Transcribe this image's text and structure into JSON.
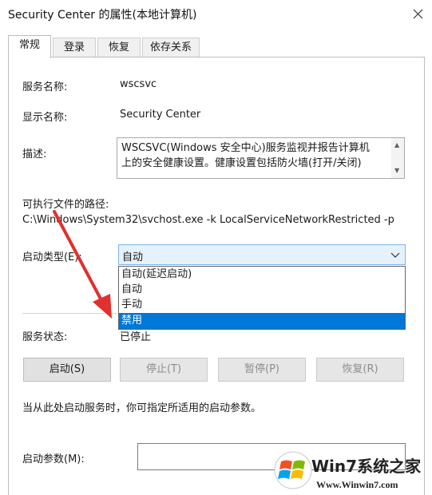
{
  "window": {
    "title": "Security Center 的属性(本地计算机)"
  },
  "tabs": [
    {
      "label": "常规",
      "active": true
    },
    {
      "label": "登录",
      "active": false
    },
    {
      "label": "恢复",
      "active": false
    },
    {
      "label": "依存关系",
      "active": false
    }
  ],
  "general": {
    "service_name_label": "服务名称:",
    "service_name_value": "wscsvc",
    "display_name_label": "显示名称:",
    "display_name_value": "Security Center",
    "description_label": "描述:",
    "description_value": "WSCSVC(Windows 安全中心)服务监视并报告计算机\n上的安全健康设置。健康设置包括防火墙(打开/关闭)",
    "path_label": "可执行文件的路径:",
    "path_value": "C:\\Windows\\System32\\svchost.exe -k LocalServiceNetworkRestricted -p",
    "startup_type_label": "启动类型(E):",
    "startup_type_value": "自动",
    "startup_options": [
      {
        "label": "自动(延迟启动)",
        "selected": false
      },
      {
        "label": "自动",
        "selected": false
      },
      {
        "label": "手动",
        "selected": false
      },
      {
        "label": "禁用",
        "selected": true
      }
    ],
    "service_status_label": "服务状态:",
    "service_status_value": "已停止",
    "buttons": {
      "start": "启动(S)",
      "stop": "停止(T)",
      "pause": "暂停(P)",
      "resume": "恢复(R)"
    },
    "hint_text": "当从此处启动服务时，你可指定所适用的启动参数。",
    "start_params_label": "启动参数(M):",
    "start_params_value": ""
  },
  "watermark": {
    "logo_text": "Win7系统之家",
    "url": "Www.Winwin7.com"
  },
  "colors": {
    "selection": "#0078d7",
    "combo_bg": "#e5f1fb",
    "arrow": "#e03030"
  }
}
